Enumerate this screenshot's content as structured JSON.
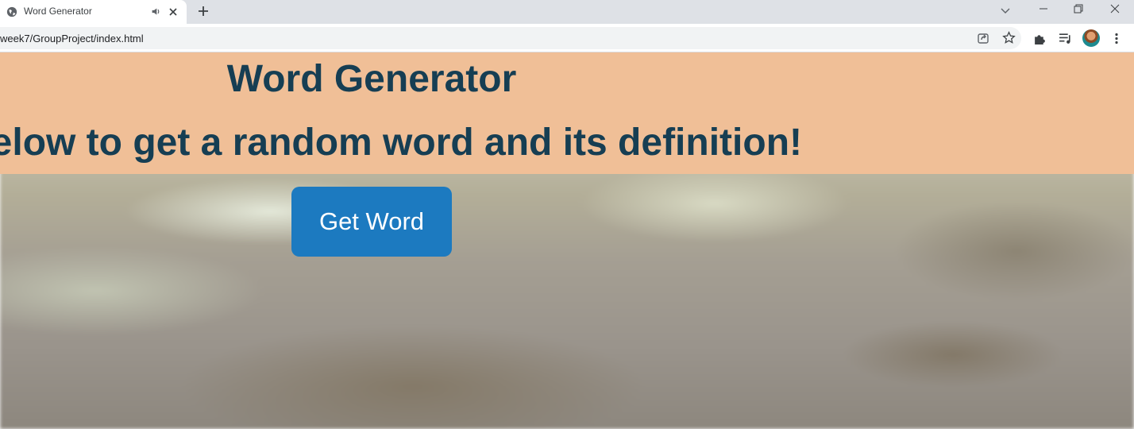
{
  "browser": {
    "tab": {
      "title": "Word Generator"
    },
    "address_bar": {
      "url": "week7/GroupProject/index.html"
    }
  },
  "page": {
    "title": "Word Generator",
    "subtitle": "ck below to get a random word and its definition!",
    "button_label": "Get Word"
  },
  "colors": {
    "header_band": "#f0bf97",
    "heading_text": "#163e53",
    "button_bg": "#1c7ac0",
    "button_text": "#ffffff"
  },
  "icons": [
    "globe-icon",
    "speaker-icon",
    "close-icon",
    "plus-icon",
    "chevron-down-icon",
    "minimize-icon",
    "restore-icon",
    "window-close-icon",
    "share-icon",
    "star-icon",
    "puzzle-icon",
    "media-queue-icon",
    "avatar",
    "more-vert-icon"
  ]
}
